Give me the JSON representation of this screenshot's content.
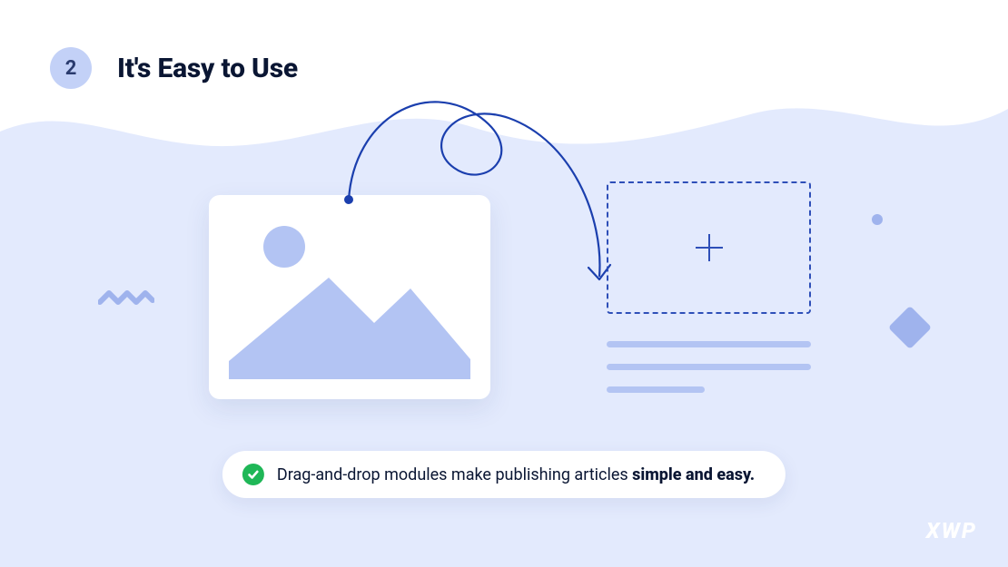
{
  "step": {
    "number": "2",
    "title": "It's Easy to Use"
  },
  "caption": {
    "prefix": "Drag-and-drop modules make publishing articles ",
    "emphasis": "simple and easy."
  },
  "brand": "XWP",
  "colors": {
    "bg": "#E3EAFD",
    "accent": "#2E4FB8",
    "soft": "#B3C4F3",
    "success": "#1FB757"
  }
}
